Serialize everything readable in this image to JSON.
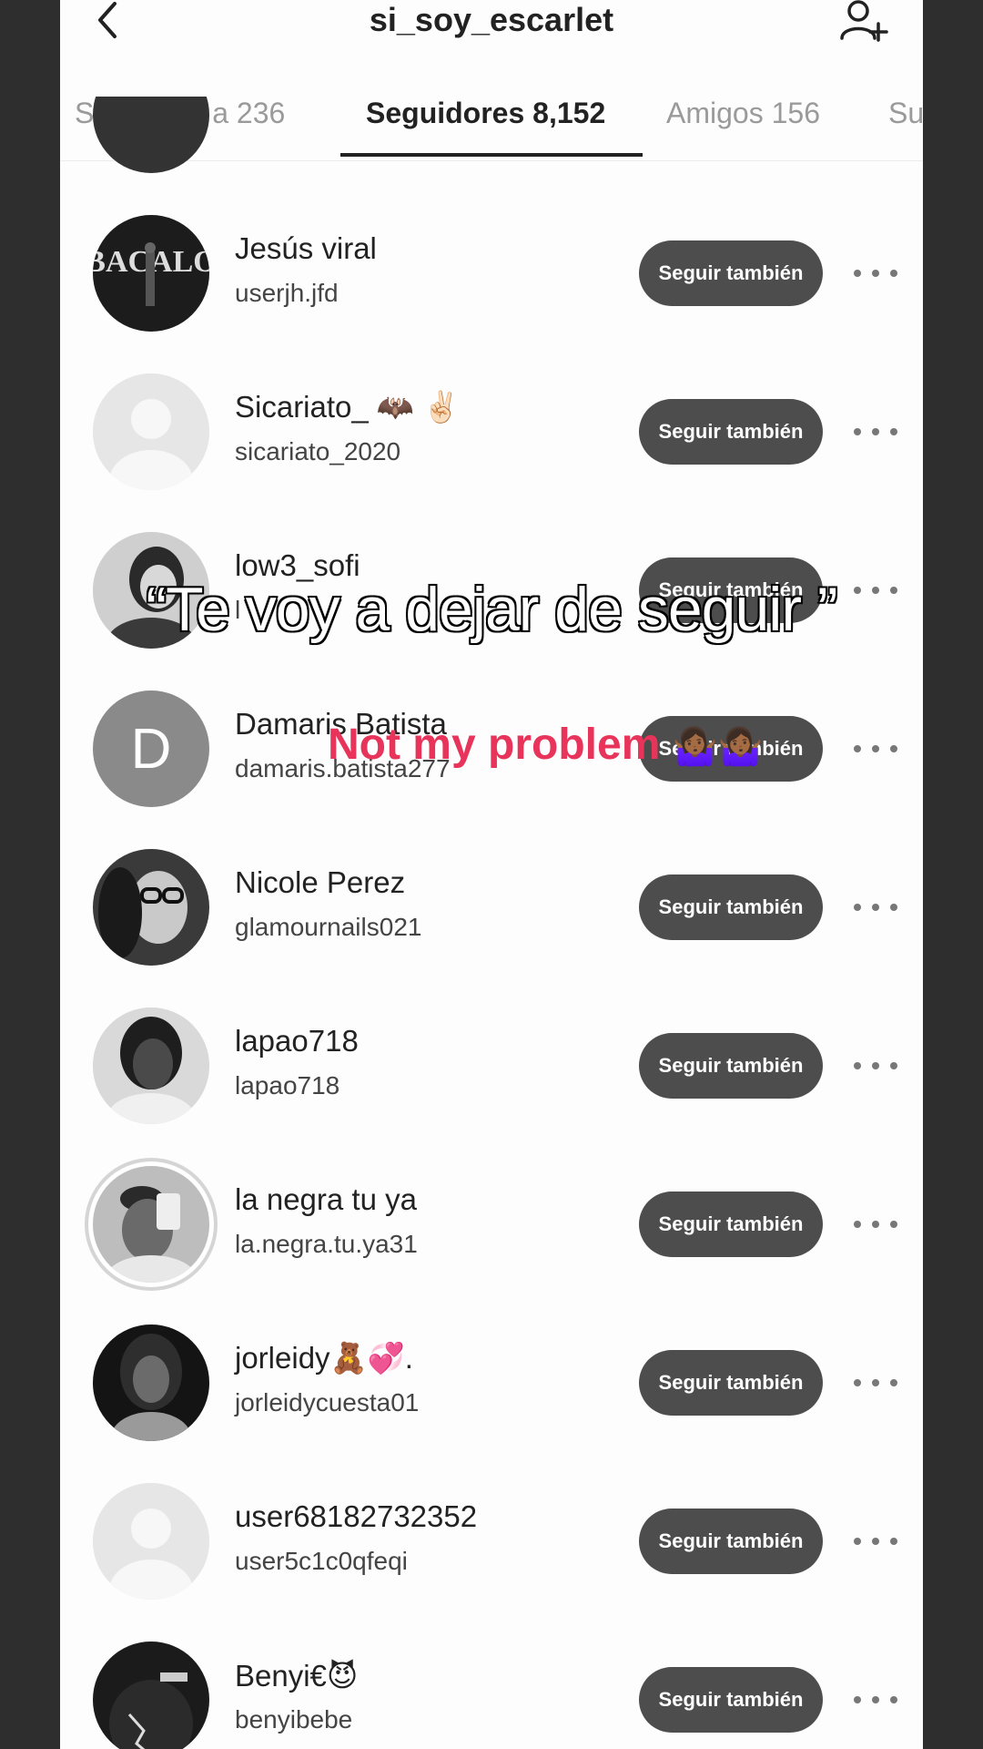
{
  "header": {
    "title": "si_soy_escarlet",
    "back_icon": "chevron-left-icon",
    "add_user_icon": "add-user-icon"
  },
  "tabs": [
    {
      "label": "Siguiendo a 236"
    },
    {
      "label": "Seguidores 8,152"
    },
    {
      "label": "Amigos 156"
    },
    {
      "label": "Su"
    }
  ],
  "rows": [
    {
      "name": "Jesús viral",
      "handle": "userjh.jfd",
      "button": "Seguir también"
    },
    {
      "name": "Sicariato_ 🦇 ✌🏻",
      "handle": "sicariato_2020",
      "button": "Seguir también"
    },
    {
      "name": "low3_sofi",
      "handle": "l",
      "button": "Seguir también"
    },
    {
      "name": "Damaris Batista",
      "handle": "damaris.batista277",
      "button": "Seguir también",
      "avatar_letter": "D"
    },
    {
      "name": "Nicole Perez",
      "handle": "glamournails021",
      "button": "Seguir también"
    },
    {
      "name": "lapao718",
      "handle": "lapao718",
      "button": "Seguir también"
    },
    {
      "name": "la negra tu ya",
      "handle": "la.negra.tu.ya31",
      "button": "Seguir también"
    },
    {
      "name": "jorleidy🧸💞.",
      "handle": "jorleidycuesta01",
      "button": "Seguir también"
    },
    {
      "name": "user68182732352",
      "handle": "user5c1c0qfeqi",
      "button": "Seguir también"
    },
    {
      "name": "Benyi€😈",
      "handle": "benyibebe",
      "button": "Seguir también"
    }
  ],
  "overlay": {
    "main_text": "“Te voy a dejar de seguir ”",
    "sub_text": "Not my problem",
    "sub_emoji": "🤷🏾‍♀️🤷🏾‍♀️"
  },
  "colors": {
    "follow_button": "#4d4d4d",
    "overlay_sub": "#e8345b"
  }
}
